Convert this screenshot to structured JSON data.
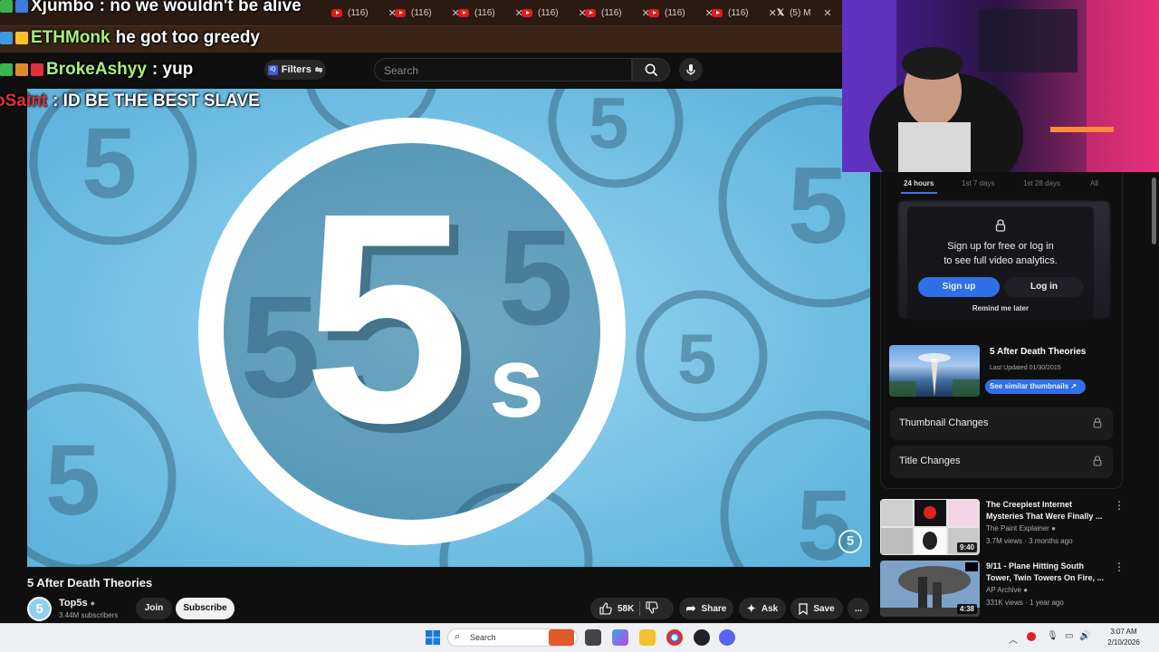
{
  "browser": {
    "tabs": [
      {
        "label": "(116)"
      },
      {
        "label": "(116)"
      },
      {
        "label": "(116)"
      },
      {
        "label": "(116)"
      },
      {
        "label": "(116)"
      },
      {
        "label": "(116)"
      },
      {
        "label": "(116)"
      },
      {
        "label": "(5) M"
      }
    ]
  },
  "chat": [
    {
      "user": "Xjumbo",
      "user_color": "#ffffff",
      "text": ": no we wouldn't be alive"
    },
    {
      "user": "ETHMonk",
      "user_color": "#a8f07a",
      "text": " he got too greedy"
    },
    {
      "user": "BrokeAshyy",
      "user_color": "#a8f07a",
      "text": " : yup"
    },
    {
      "user": "oSaint",
      "user_color": "#e0303a",
      "text": " : ID BE THE BEST SLAVE"
    }
  ],
  "youtube_header": {
    "filters_label": "Filters",
    "search_placeholder": "Search"
  },
  "video": {
    "title": "5 After Death Theories",
    "logo_main": "5",
    "logo_sub": "s",
    "watermark": "5"
  },
  "channel": {
    "name": "Top5s",
    "subscribers": "3.44M subscribers",
    "avatar_text": "5",
    "join_label": "Join",
    "subscribe_label": "Subscribe"
  },
  "actions": {
    "likes": "58K",
    "share_label": "Share",
    "ask_label": "Ask",
    "save_label": "Save",
    "more_label": "..."
  },
  "analytics": {
    "ranges": [
      "24 hours",
      "1st 7 days",
      "1st 28 days",
      "All"
    ],
    "signup_line1": "Sign up for free or log in",
    "signup_line2": "to see full video analytics.",
    "signup_button": "Sign up",
    "login_button": "Log in",
    "remind_label": "Remind me later",
    "video_title": "5 After Death Theories",
    "last_updated": "Last Updated 01/30/2015",
    "similar_button": "See similar thumbnails ↗",
    "thumbnail_changes": "Thumbnail Changes",
    "title_changes": "Title Changes",
    "accent": "#2f6fe8"
  },
  "recommendations": [
    {
      "title": "The Creepiest Internet Mysteries That Were Finally ...",
      "channel": "The Paint Explainer",
      "meta": "3.7M views · 3 months ago",
      "duration": "9:40"
    },
    {
      "title": "9/11 - Plane Hitting South Tower, Twin Towers On Fire, ...",
      "channel": "AP Archive",
      "meta": "331K views · 1 year ago",
      "duration": "4:38"
    }
  ],
  "taskbar": {
    "search_placeholder": "Search",
    "time": "3:07 AM",
    "date": "2/10/2026"
  }
}
